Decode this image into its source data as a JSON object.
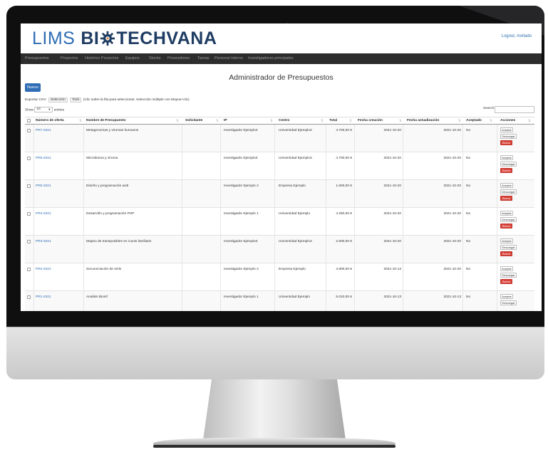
{
  "app": {
    "brand_lims": "LIMS",
    "brand_bio_prefix": "BI",
    "brand_rest": "TECHVANA",
    "logout": "Logout, invitado"
  },
  "nav": {
    "items": [
      "Presupuestos",
      "Proyectos",
      "Histórico Proyectos",
      "Equipos",
      "Stocks",
      "Proveedores",
      "Tareas",
      "Personal interno",
      "Investigadores principales"
    ]
  },
  "page": {
    "title": "Administrador de Presupuestos",
    "new_button": "Nuevo",
    "csv_label": "Exportar CSV:",
    "csv_selection": "Selección",
    "csv_all": "Todo",
    "csv_hint": "(Clic sobre la fila para seleccionar. Selección múltiple con Mayus+clic)",
    "show_label": "Show",
    "show_value": "10",
    "entries_label": "entries",
    "search_label": "Search:"
  },
  "table": {
    "headers": [
      "Número de oferta",
      "Nombre de Presupuesto",
      "Solicitante",
      "IP",
      "Centro",
      "Total",
      "Fecha creación",
      "Fecha actualización",
      "Aceptado",
      "Acciones"
    ],
    "actions": {
      "accept": "Aceptar",
      "download": "Descargar",
      "delete": "Borrar"
    },
    "rows": [
      {
        "num": "PR7-2021",
        "name": "Metagenomas y viromas humanos",
        "solicitante": "",
        "ip": "Investigador Ejemplo3",
        "centro": "Universidad Ejemplo3",
        "total": "4.700,00 €",
        "creacion": "2021-10-20",
        "actualizacion": "2021-10-20",
        "aceptado": "No"
      },
      {
        "num": "PR6-2021",
        "name": "Microbioma y viroma",
        "solicitante": "",
        "ip": "Investigador Ejemplo3",
        "centro": "Universidad Ejemplo3",
        "total": "4.700,00 €",
        "creacion": "2021-10-20",
        "actualizacion": "2021-10-20",
        "aceptado": "No"
      },
      {
        "num": "PR5-2021",
        "name": "Diseño y programación web",
        "solicitante": "",
        "ip": "Investigador Ejemplo 2",
        "centro": "Empresa Ejemplo",
        "total": "1.600,00 €",
        "creacion": "2021-10-20",
        "actualizacion": "2021-10-20",
        "aceptado": "No"
      },
      {
        "num": "PR4-2021",
        "name": "Desarrollo y programación PHP",
        "solicitante": "",
        "ip": "Investigador Ejemplo 1",
        "centro": "Universidad Ejemplo",
        "total": "4.260,00 €",
        "creacion": "2021-10-20",
        "actualizacion": "2021-10-20",
        "aceptado": "No"
      },
      {
        "num": "PR3-2021",
        "name": "Mapeo de transposibles en Canis familiaris",
        "solicitante": "",
        "ip": "Investigador Ejemplo3",
        "centro": "Universidad Ejemplo3",
        "total": "2.500,00 €",
        "creacion": "2021-10-20",
        "actualizacion": "2021-10-20",
        "aceptado": "No"
      },
      {
        "num": "PR2-2021",
        "name": "Secuenciación de ADN",
        "solicitante": "",
        "ip": "Investigador Ejemplo 2",
        "centro": "Empresa Ejemplo",
        "total": "4.900,00 €",
        "creacion": "2021-10-13",
        "actualizacion": "2021-10-20",
        "aceptado": "No"
      },
      {
        "num": "PR1-2021",
        "name": "Analisis Bioinf",
        "solicitante": "",
        "ip": "Investigador Ejemplo 1",
        "centro": "Universidad Ejemplo",
        "total": "5.010,00 €",
        "creacion": "2021-10-13",
        "actualizacion": "2021-10-13",
        "aceptado": "No"
      }
    ]
  },
  "colors": {
    "brand_blue": "#2d6db4",
    "brand_dark": "#1f3c63",
    "navbar": "#2d2d2d",
    "primary_button": "#2f6db5",
    "delete_button": "#d9433a"
  }
}
